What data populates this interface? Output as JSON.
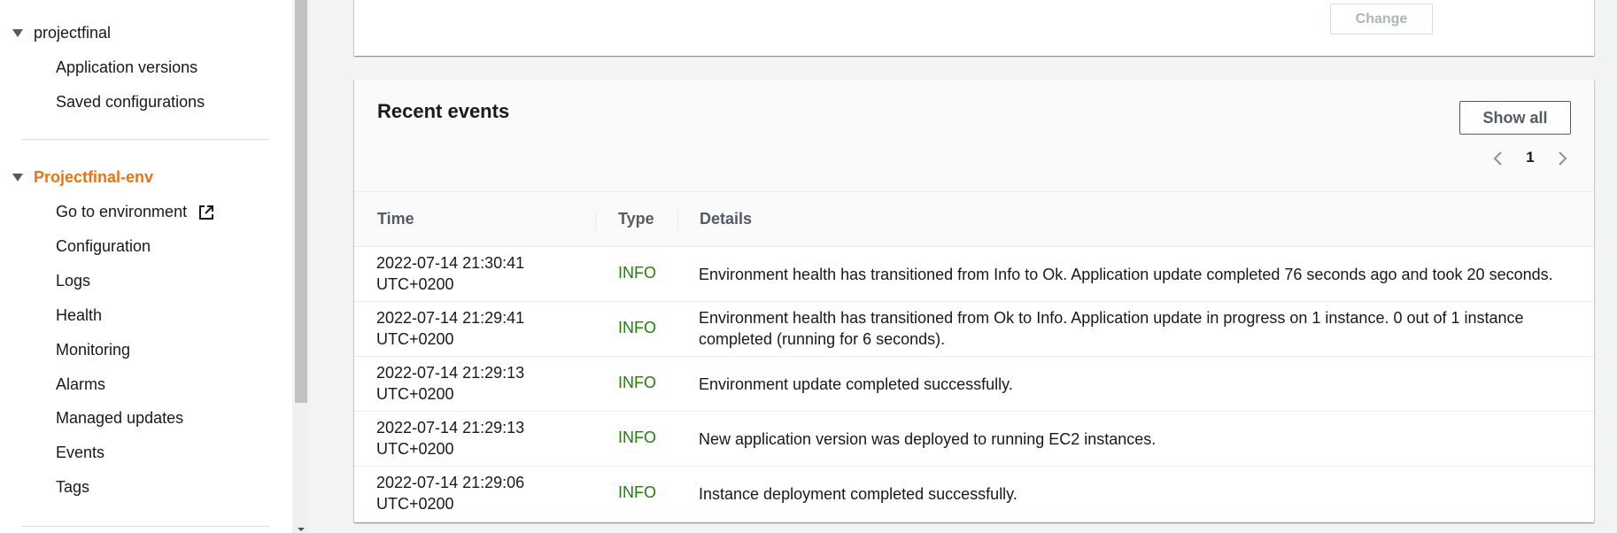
{
  "sidebar": {
    "app_name": "projectfinal",
    "app_links": [
      "Application versions",
      "Saved configurations"
    ],
    "env_name": "Projectfinal-env",
    "env_links": [
      "Go to environment",
      "Configuration",
      "Logs",
      "Health",
      "Monitoring",
      "Alarms",
      "Managed updates",
      "Events",
      "Tags"
    ]
  },
  "top_panel": {
    "change_label": "Change"
  },
  "events": {
    "title": "Recent events",
    "show_all_label": "Show all",
    "page": "1",
    "columns": {
      "time": "Time",
      "type": "Type",
      "details": "Details"
    },
    "rows": [
      {
        "time_date": "2022-07-14 21:30:41",
        "time_tz": "UTC+0200",
        "type": "INFO",
        "details": "Environment health has transitioned from Info to Ok. Application update completed 76 seconds ago and took 20 seconds."
      },
      {
        "time_date": "2022-07-14 21:29:41",
        "time_tz": "UTC+0200",
        "type": "INFO",
        "details": "Environment health has transitioned from Ok to Info. Application update in progress on 1 instance. 0 out of 1 instance completed (running for 6 seconds)."
      },
      {
        "time_date": "2022-07-14 21:29:13",
        "time_tz": "UTC+0200",
        "type": "INFO",
        "details": "Environment update completed successfully."
      },
      {
        "time_date": "2022-07-14 21:29:13",
        "time_tz": "UTC+0200",
        "type": "INFO",
        "details": "New application version was deployed to running EC2 instances."
      },
      {
        "time_date": "2022-07-14 21:29:06",
        "time_tz": "UTC+0200",
        "type": "INFO",
        "details": "Instance deployment completed successfully."
      }
    ]
  },
  "colors": {
    "accent": "#ec7211",
    "info": "#1d8102"
  },
  "icons": {
    "caret": "caret-down-icon",
    "external": "external-link-icon",
    "prev": "chevron-left-icon",
    "next": "chevron-right-icon"
  }
}
